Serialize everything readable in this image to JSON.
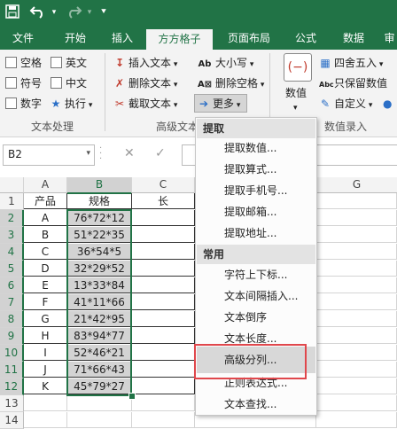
{
  "titlebar": {
    "save_icon": "save-icon",
    "undo_icon": "undo-icon",
    "redo_icon": "redo-icon",
    "customize_icon": "customize-quick-access-icon"
  },
  "tabs": [
    "文件",
    "开始",
    "插入",
    "方方格子",
    "页面布局",
    "公式",
    "数据",
    "审"
  ],
  "ribbon": {
    "checkboxes": [
      "空格",
      "英文",
      "符号",
      "中文",
      "数字"
    ],
    "execute": "执行",
    "insert_text": "插入文本",
    "delete_text": "删除文本",
    "extract_text": "截取文本",
    "case": "大小写",
    "delete_space": "删除空格",
    "more": "更多",
    "value": "数值",
    "round": "四舍五入",
    "keep_value": "只保留数值",
    "custom": "自定义",
    "groups": {
      "text_process": "文本处理",
      "advanced_text": "高级文本",
      "value_entry": "数值录入"
    }
  },
  "formula_bar": {
    "name_box": "B2",
    "cancel": "✕",
    "confirm": "✓"
  },
  "sheet": {
    "columns": [
      "A",
      "B",
      "C",
      "G"
    ],
    "rows": [
      "1",
      "2",
      "3",
      "4",
      "5",
      "6",
      "7",
      "8",
      "9",
      "10",
      "11",
      "12",
      "13",
      "14"
    ],
    "header_row": [
      "产品",
      "规格",
      "长"
    ],
    "data": [
      [
        "A",
        "76*72*12"
      ],
      [
        "B",
        "51*22*35"
      ],
      [
        "C",
        "36*54*5"
      ],
      [
        "D",
        "32*29*52"
      ],
      [
        "E",
        "13*33*84"
      ],
      [
        "F",
        "41*11*66"
      ],
      [
        "G",
        "21*42*95"
      ],
      [
        "H",
        "83*94*77"
      ],
      [
        "I",
        "52*46*21"
      ],
      [
        "J",
        "71*66*43"
      ],
      [
        "K",
        "45*79*27"
      ]
    ]
  },
  "menu": {
    "section1": "提取",
    "items1": [
      "提取数值...",
      "提取算式...",
      "提取手机号...",
      "提取邮箱...",
      "提取地址..."
    ],
    "section2": "常用",
    "items2": [
      "字符上下标...",
      "文本间隔插入...",
      "文本倒序",
      "文本长度...",
      "高级分列...",
      "正则表达式...",
      "文本查找..."
    ]
  },
  "colors": {
    "accent": "#217346",
    "highlight_box": "#e0474c"
  }
}
